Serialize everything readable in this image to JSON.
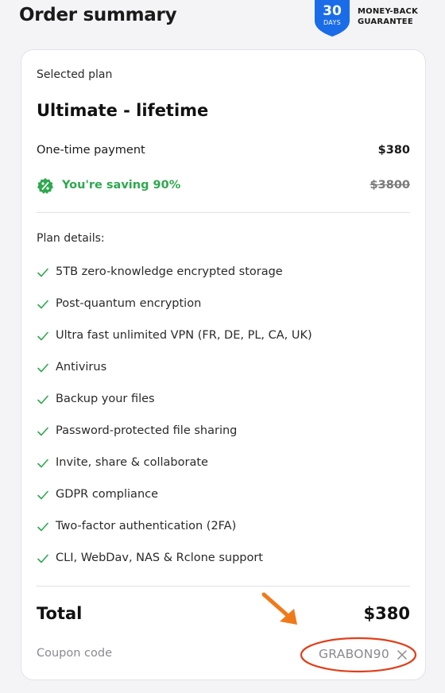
{
  "header": {
    "title": "Order summary",
    "badge": {
      "number": "30",
      "unit": "DAYS"
    },
    "guarantee": {
      "line1": "MONEY-BACK",
      "line2": "GUARANTEE"
    }
  },
  "summary": {
    "selected_label": "Selected plan",
    "plan_name": "Ultimate - lifetime",
    "payment_label": "One-time payment",
    "payment_amount": "$380",
    "saving_text": "You're saving 90%",
    "original_price": "$3800",
    "plan_details_label": "Plan details:",
    "features": [
      "5TB zero-knowledge encrypted storage",
      "Post-quantum encryption",
      "Ultra fast unlimited VPN (FR, DE, PL, CA, UK)",
      "Antivirus",
      "Backup your files",
      "Password-protected file sharing",
      "Invite, share & collaborate",
      "GDPR compliance",
      "Two-factor authentication (2FA)",
      "CLI, WebDav, NAS & Rclone support"
    ],
    "total_label": "Total",
    "total_amount": "$380",
    "coupon_label": "Coupon code",
    "coupon_value": "GRABON90"
  },
  "icons": {
    "badge": "shield-badge-icon",
    "saving": "discount-percent-icon",
    "feature": "check-icon",
    "coupon_clear": "close-icon",
    "annotation_arrow": "arrow-annotation-icon"
  },
  "colors": {
    "accent_blue": "#1a6ce8",
    "success_green": "#2fa84f",
    "annotation_red": "#e0401c",
    "annotation_orange": "#f07a1a"
  }
}
